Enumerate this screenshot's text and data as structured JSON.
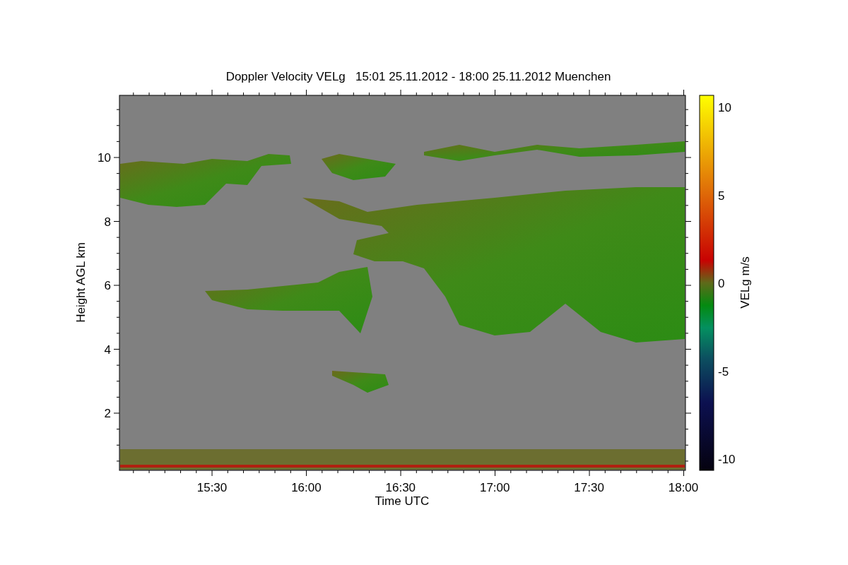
{
  "title": "Doppler Velocity VELg   15:01 25.11.2012 - 18:00 25.11.2012 Muenchen",
  "y_axis": {
    "label": "Height AGL km",
    "ticks": [
      "10",
      "8",
      "6",
      "4",
      "2"
    ]
  },
  "x_axis": {
    "label": "Time UTC",
    "ticks": [
      "15:30",
      "16:00",
      "16:30",
      "17:00",
      "17:30",
      "18:00"
    ]
  },
  "colorbar": {
    "label": "VELg m/s",
    "ticks": [
      "10",
      "5",
      "0",
      "-5",
      "-10"
    ]
  }
}
